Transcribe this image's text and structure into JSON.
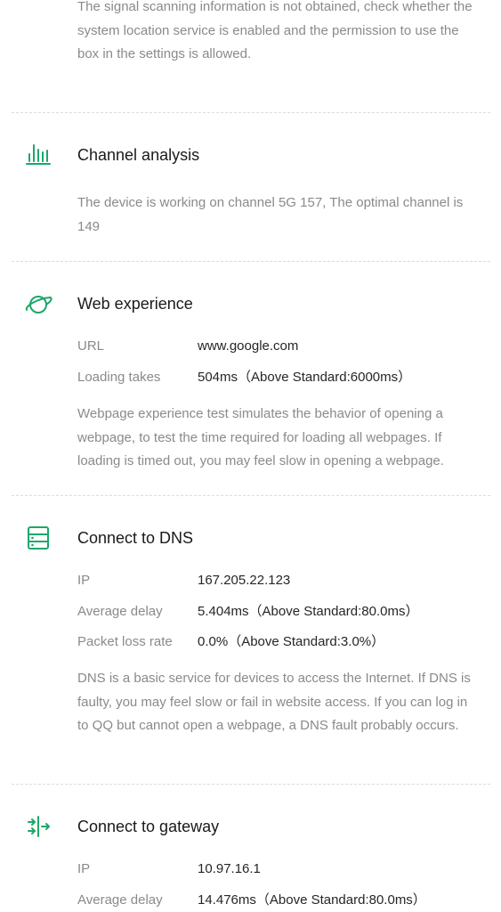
{
  "colors": {
    "accent": "#1ba86a",
    "divider": "#dcdcdc",
    "muted": "#8a8a8a",
    "text": "#1a1a1a"
  },
  "top_notice": "The signal scanning information is not obtained, check whether the system location service is enabled and the permission to use the box in the settings is allowed.",
  "sections": {
    "channel": {
      "icon": "bar-chart-icon",
      "title": "Channel analysis",
      "description": "The device is working on channel 5G 157, The optimal channel is 149"
    },
    "web": {
      "icon": "globe-orbit-icon",
      "title": "Web experience",
      "rows": [
        {
          "label": "URL",
          "value": "www.google.com"
        },
        {
          "label": "Loading takes",
          "value": "504ms（Above Standard:6000ms）"
        }
      ],
      "description": "Webpage experience test simulates the behavior of opening a webpage, to test the time required for loading all webpages. If loading is timed out, you may feel slow in opening a webpage."
    },
    "dns": {
      "icon": "server-icon",
      "title": "Connect to DNS",
      "rows": [
        {
          "label": "IP",
          "value": "167.205.22.123"
        },
        {
          "label": "Average delay",
          "value": "5.404ms（Above Standard:80.0ms）"
        },
        {
          "label": "Packet loss rate",
          "value": "0.0%（Above Standard:3.0%）"
        }
      ],
      "description": "DNS is a basic service for devices to access the Internet. If DNS is faulty, you may feel slow or fail in website access. If you can log in to QQ but cannot open a webpage, a DNS fault probably occurs."
    },
    "gateway": {
      "icon": "gateway-arrows-icon",
      "title": "Connect to gateway",
      "rows": [
        {
          "label": "IP",
          "value": "10.97.16.1"
        },
        {
          "label": "Average delay",
          "value": "14.476ms（Above Standard:80.0ms）"
        }
      ]
    }
  }
}
